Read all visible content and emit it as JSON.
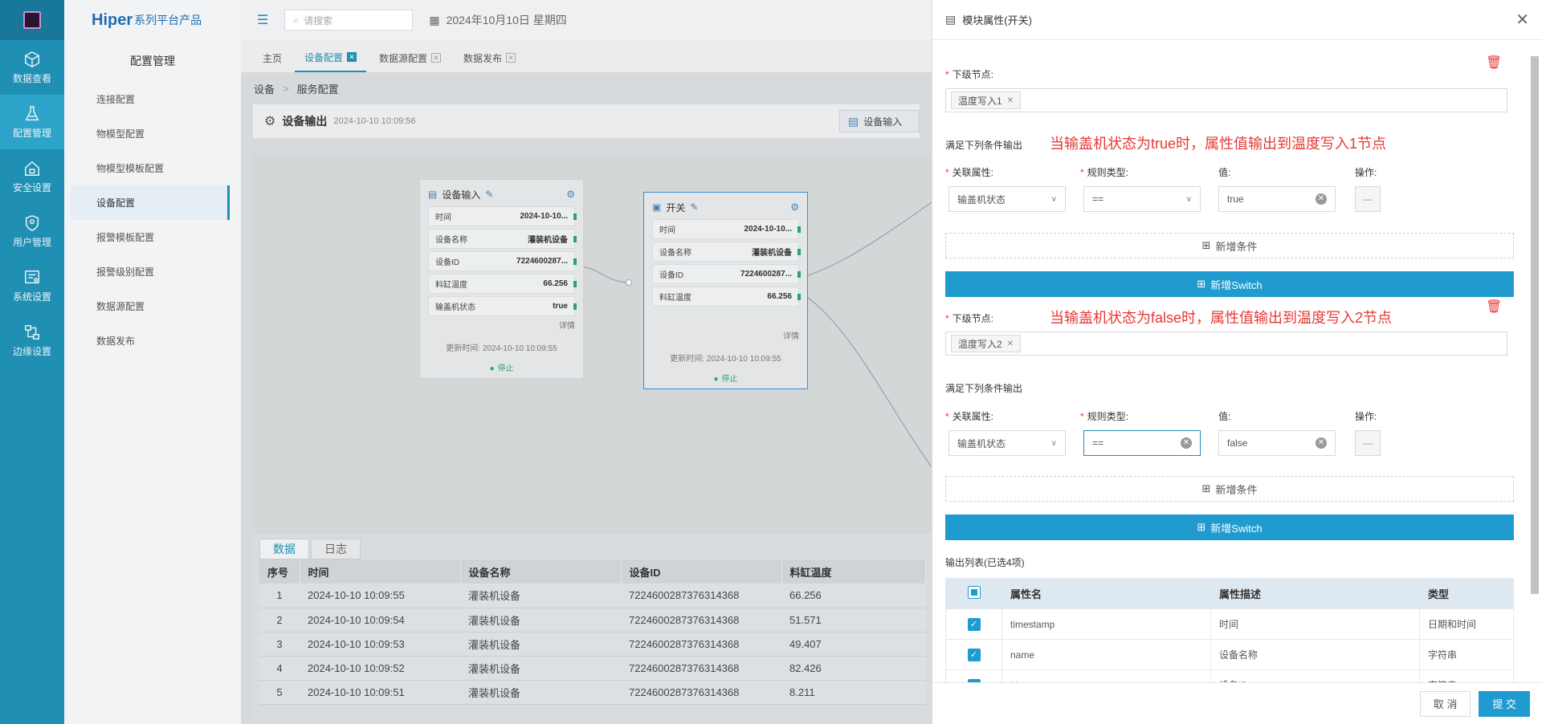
{
  "rail": {
    "items": [
      {
        "label": "数据查看",
        "icon": "cube-icon"
      },
      {
        "label": "配置管理",
        "icon": "flask-icon"
      },
      {
        "label": "安全设置",
        "icon": "home-lock-icon"
      },
      {
        "label": "用户管理",
        "icon": "shield-user-icon"
      },
      {
        "label": "系统设置",
        "icon": "system-settings-icon"
      },
      {
        "label": "边缘设置",
        "icon": "network-icon"
      }
    ]
  },
  "sidebar": {
    "brand": "Hiper",
    "brand_sub": "系列平台产品",
    "section": "配置管理",
    "items": [
      {
        "label": "连接配置"
      },
      {
        "label": "物模型配置"
      },
      {
        "label": "物模型模板配置"
      },
      {
        "label": "设备配置"
      },
      {
        "label": "报警模板配置"
      },
      {
        "label": "报警级别配置"
      },
      {
        "label": "数据源配置"
      },
      {
        "label": "数据发布"
      }
    ]
  },
  "topbar": {
    "search_placeholder": "请搜索",
    "date": "2024年10月10日 星期四"
  },
  "tabs": [
    {
      "label": "主页"
    },
    {
      "label": "设备配置"
    },
    {
      "label": "数据源配置"
    },
    {
      "label": "数据发布"
    }
  ],
  "breadcrumb": {
    "a": "设备",
    "sep": ">",
    "b": "服务配置"
  },
  "output_header": {
    "title": "设备输出",
    "timestamp": "2024-10-10 10:09:56",
    "pill": "设备输入"
  },
  "node_input": {
    "title": "设备输入",
    "rows": [
      {
        "k": "时间",
        "v": "2024-10-10..."
      },
      {
        "k": "设备名称",
        "v": "灌装机设备"
      },
      {
        "k": "设备ID",
        "v": "7224600287..."
      },
      {
        "k": "料缸温度",
        "v": "66.256"
      },
      {
        "k": "输盖机状态",
        "v": "true"
      }
    ],
    "detail": "详情",
    "updated": "更新时间: 2024-10-10 10:09:55",
    "status": "停止"
  },
  "node_switch": {
    "title": "开关",
    "rows": [
      {
        "k": "时间",
        "v": "2024-10-10..."
      },
      {
        "k": "设备名称",
        "v": "灌装机设备"
      },
      {
        "k": "设备ID",
        "v": "7224600287..."
      },
      {
        "k": "料缸温度",
        "v": "66.256"
      }
    ],
    "detail": "详情",
    "updated": "更新时间: 2024-10-10 10:09:55",
    "status": "停止"
  },
  "bottom": {
    "tabs": [
      "数据",
      "日志"
    ],
    "columns": [
      "序号",
      "时间",
      "设备名称",
      "设备ID",
      "料缸温度"
    ],
    "rows": [
      [
        "1",
        "2024-10-10 10:09:55",
        "灌装机设备",
        "7224600287376314368",
        "66.256"
      ],
      [
        "2",
        "2024-10-10 10:09:54",
        "灌装机设备",
        "7224600287376314368",
        "51.571"
      ],
      [
        "3",
        "2024-10-10 10:09:53",
        "灌装机设备",
        "7224600287376314368",
        "49.407"
      ],
      [
        "4",
        "2024-10-10 10:09:52",
        "灌装机设备",
        "7224600287376314368",
        "82.426"
      ],
      [
        "5",
        "2024-10-10 10:09:51",
        "灌装机设备",
        "7224600287376314368",
        "8.211"
      ]
    ]
  },
  "drawer": {
    "title": "模块属性(开关)",
    "next_node_label": "下级节点:",
    "cond_title": "满足下列条件输出",
    "assoc_label": "关联属性:",
    "rule_label": "规则类型:",
    "value_label": "值:",
    "op_label": "操作:",
    "add_condition": "新增条件",
    "add_switch": "新增Switch",
    "block1": {
      "tag": "温度写入1",
      "annotation": "当输盖机状态为true时，属性值输出到温度写入1节点",
      "assoc": "输盖机状态",
      "rule": "==",
      "value": "true"
    },
    "block2": {
      "tag": "温度写入2",
      "annotation": "当输盖机状态为false时，属性值输出到温度写入2节点",
      "assoc": "输盖机状态",
      "rule": "==",
      "value": "false"
    },
    "output_list_title": "输出列表(已选4项)",
    "output_columns": [
      "属性名",
      "属性描述",
      "类型"
    ],
    "output_rows": [
      [
        "timestamp",
        "时间",
        "日期和时间"
      ],
      [
        "name",
        "设备名称",
        "字符串"
      ],
      [
        "id",
        "设备ID",
        "字符串"
      ]
    ],
    "cancel": "取 消",
    "submit": "提 交"
  }
}
